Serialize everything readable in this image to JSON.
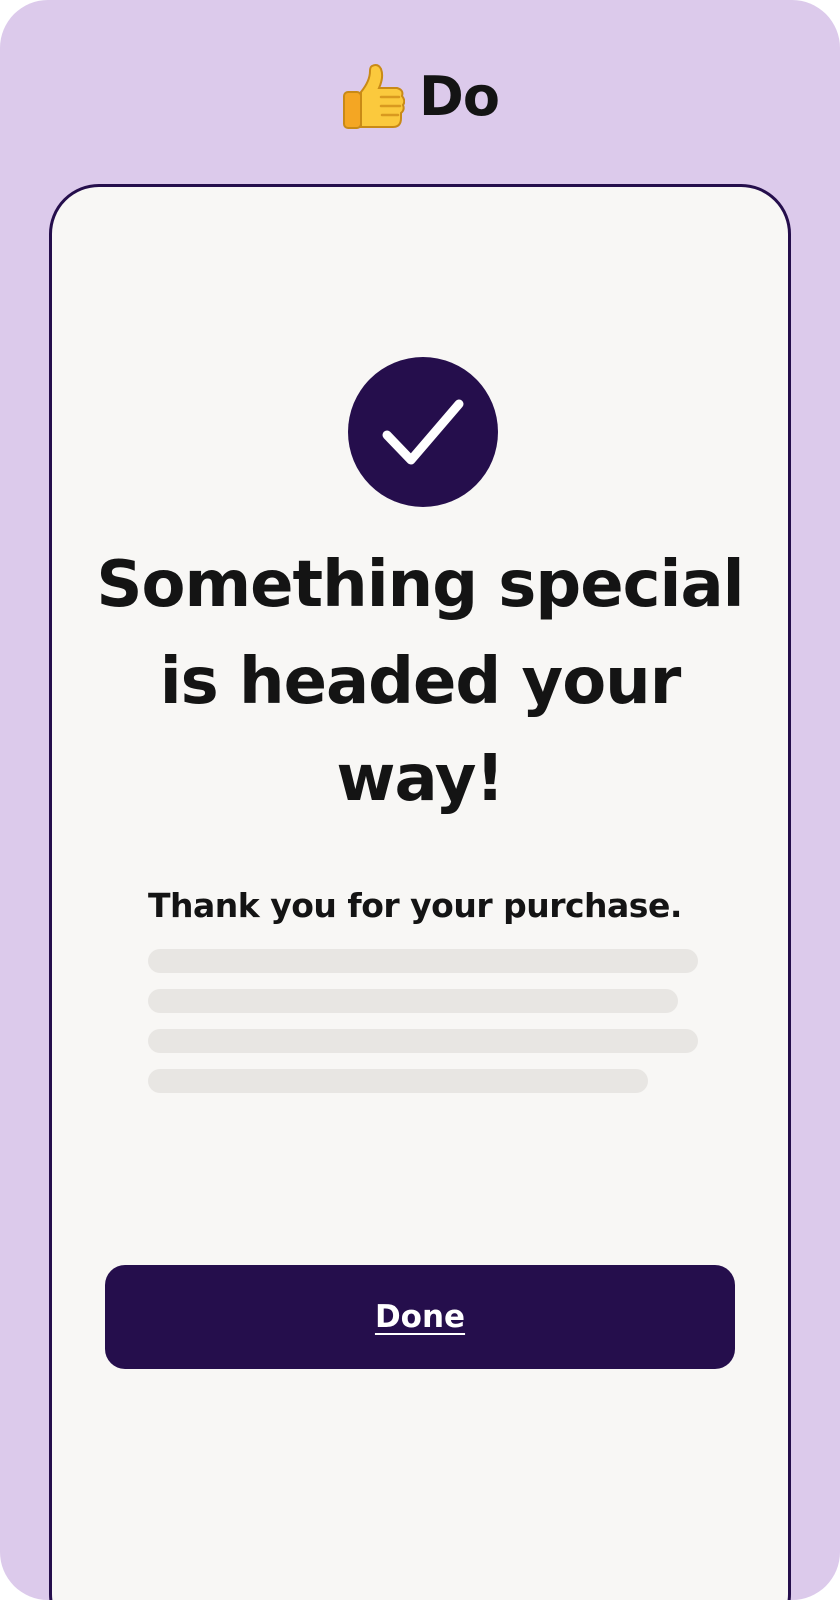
{
  "header": {
    "icon": "thumbs-up-icon",
    "label": "Do"
  },
  "confirmation": {
    "icon": "checkmark-icon",
    "headline": "Something special is headed your way!",
    "message": "Thank you for your purchase."
  },
  "actions": {
    "done_label": "Done"
  },
  "colors": {
    "background": "#dccaeb",
    "accent": "#250e4c",
    "surface": "#f8f7f5",
    "placeholder": "#e8e6e3"
  }
}
